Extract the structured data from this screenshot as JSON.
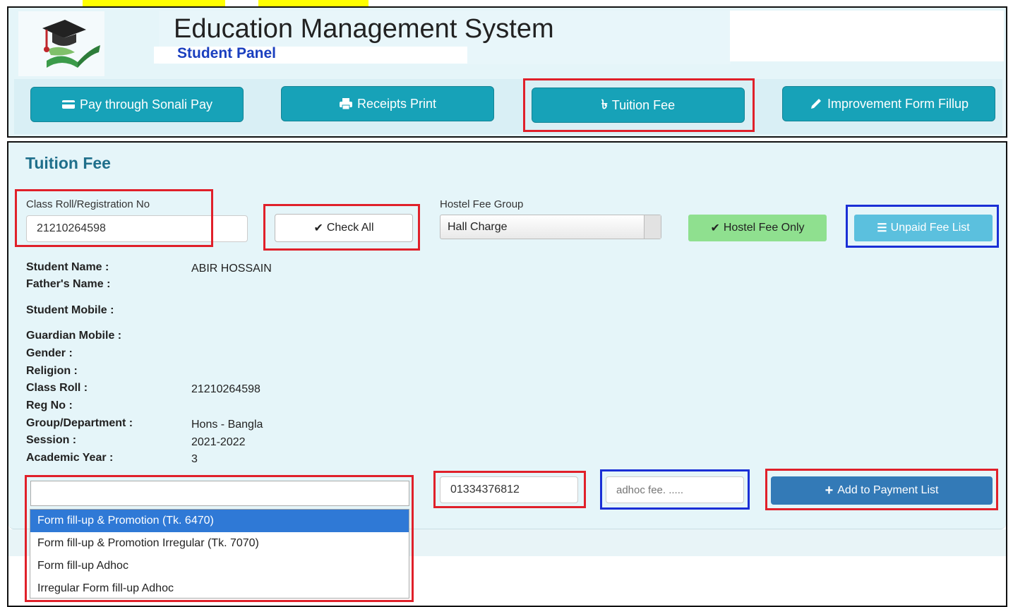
{
  "highlights": [
    "#ffff00"
  ],
  "header": {
    "title": "Education Management System",
    "subtitle": "Student Panel",
    "logo_icon": "graduation-cap-book-icon"
  },
  "nav": {
    "buttons": [
      {
        "label": "Pay through Sonali Pay",
        "icon": "credit-card-icon"
      },
      {
        "label": "Receipts Print",
        "icon": "printer-icon"
      },
      {
        "label": "Tuition Fee",
        "icon": "taka-icon"
      },
      {
        "label": "Improvement Form Fillup",
        "icon": "pencil-icon"
      }
    ]
  },
  "form": {
    "section_title": "Tuition Fee",
    "roll_label": "Class Roll/Registration No",
    "roll_value": "21210264598",
    "check_all_label": "Check All",
    "hostel_group_label": "Hostel Fee Group",
    "hostel_group_value": "Hall Charge",
    "hostel_only_label": "Hostel Fee Only",
    "unpaid_list_label": "Unpaid Fee List"
  },
  "student": {
    "fields": [
      {
        "label": "Student Name :",
        "value": "ABIR HOSSAIN"
      },
      {
        "label": "Father's Name :",
        "value": ""
      },
      {
        "label": "Student Mobile :",
        "value": ""
      },
      {
        "label": "Guardian Mobile :",
        "value": ""
      },
      {
        "label": "Gender :",
        "value": ""
      },
      {
        "label": "Religion :",
        "value": ""
      },
      {
        "label": "Class Roll :",
        "value": "21210264598"
      },
      {
        "label": "Reg No :",
        "value": ""
      },
      {
        "label": "Group/Department :",
        "value": "Hons - Bangla"
      },
      {
        "label": "Session :",
        "value": "2021-2022"
      },
      {
        "label": "Academic Year :",
        "value": "3"
      }
    ]
  },
  "payment": {
    "fee_select_value": "",
    "mobile_value": "01334376812",
    "adhoc_placeholder": "adhoc fee. .....",
    "add_button_label": "Add to Payment List",
    "options": [
      "Form fill-up & Promotion (Tk. 6470)",
      "Form fill-up & Promotion Irregular (Tk. 7070)",
      "Form fill-up Adhoc",
      "Irregular Form fill-up Adhoc"
    ],
    "selected_index": 0
  },
  "colors": {
    "accent": "#17a2b8",
    "primary": "#337ab7",
    "success_light": "#8fe08f",
    "info_light": "#5bc0de",
    "highlight_red": "#e0202a",
    "highlight_blue": "#1a2fd6"
  }
}
